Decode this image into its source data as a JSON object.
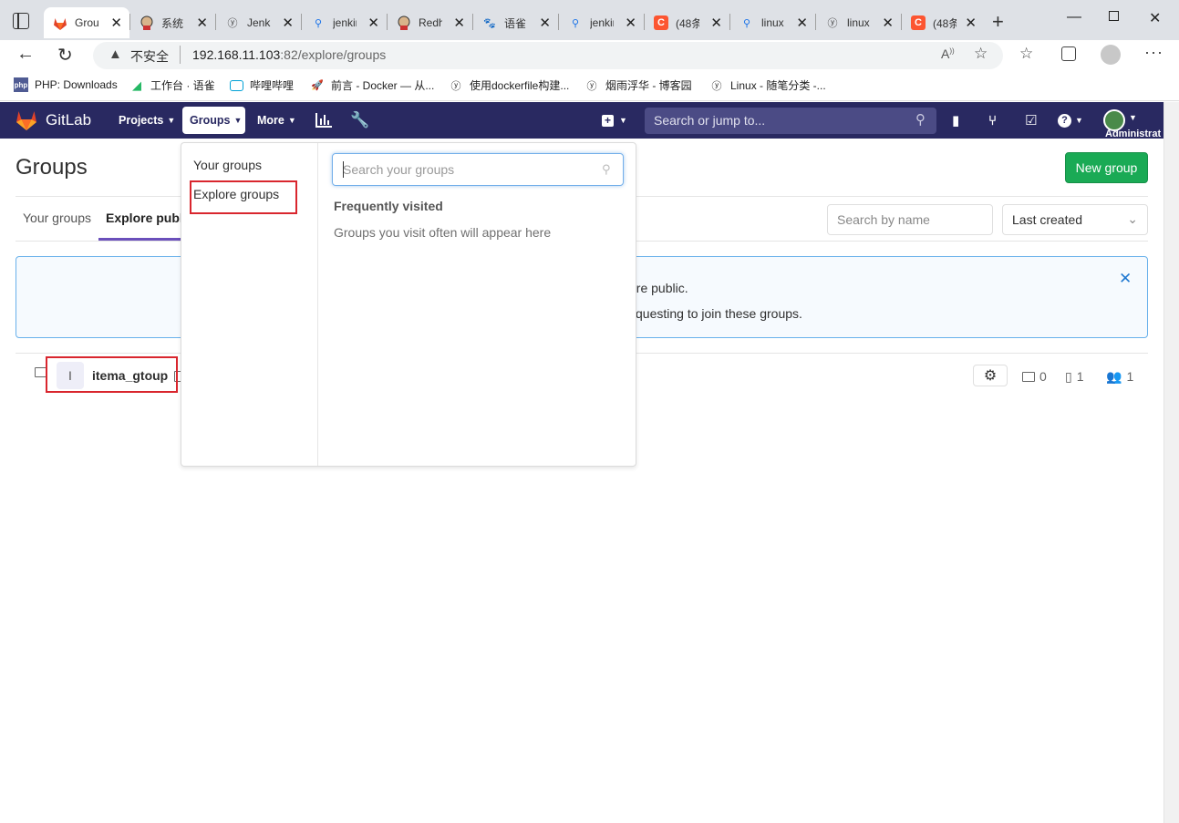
{
  "browser": {
    "tabs": [
      {
        "title": "Grou",
        "icon": "gitlab-icon"
      },
      {
        "title": "系统",
        "icon": "jenkins-icon"
      },
      {
        "title": "Jenki",
        "icon": "yuque-icon"
      },
      {
        "title": "jenkir",
        "icon": "search-icon"
      },
      {
        "title": "Redh",
        "icon": "jenkins-icon"
      },
      {
        "title": "语雀",
        "icon": "baidu-icon"
      },
      {
        "title": "jenkir",
        "icon": "search-icon"
      },
      {
        "title": "(48条",
        "icon": "csdn-icon"
      },
      {
        "title": "linux",
        "icon": "search-icon"
      },
      {
        "title": "linux",
        "icon": "yuque-icon"
      },
      {
        "title": "(48条",
        "icon": "csdn-icon"
      }
    ],
    "security": "不安全",
    "url_host": "192.168.11.103",
    "url_rest": ":82/explore/groups",
    "bookmarks": [
      {
        "label": "PHP: Downloads",
        "icon": "php-icon"
      },
      {
        "label": "工作台 · 语雀",
        "icon": "yuque-icon"
      },
      {
        "label": "哔哩哔哩",
        "icon": "bilibili-icon"
      },
      {
        "label": "前言 - Docker — 从...",
        "icon": "rocket-icon"
      },
      {
        "label": "使用dockerfile构建...",
        "icon": "yuque-icon"
      },
      {
        "label": "烟雨浮华 - 博客园",
        "icon": "yuque-icon"
      },
      {
        "label": "Linux - 随笔分类 -...",
        "icon": "yuque-icon"
      }
    ]
  },
  "nav": {
    "brand": "GitLab",
    "projects": "Projects",
    "groups": "Groups",
    "more": "More",
    "search_placeholder": "Search or jump to...",
    "user": "Administrat"
  },
  "page": {
    "title": "Groups",
    "new_group": "New group",
    "tab_your": "Your groups",
    "tab_explore": "Explore publi",
    "filter_placeholder": "Search by name",
    "sort": "Last created",
    "alert_line1": "are public.",
    "alert_line2": "questing to join these groups.",
    "group": {
      "avatar": "I",
      "name": "itema_gtoup",
      "subgroups": "0",
      "projects": "1",
      "members": "1"
    }
  },
  "dropdown": {
    "your_groups": "Your groups",
    "explore_groups": "Explore groups",
    "search_placeholder": "Search your groups",
    "frequent_title": "Frequently visited",
    "frequent_empty": "Groups you visit often will appear here"
  },
  "colors": {
    "nav": "#292961",
    "accent": "#1aaa55",
    "highlight_box": "#d9262e"
  }
}
